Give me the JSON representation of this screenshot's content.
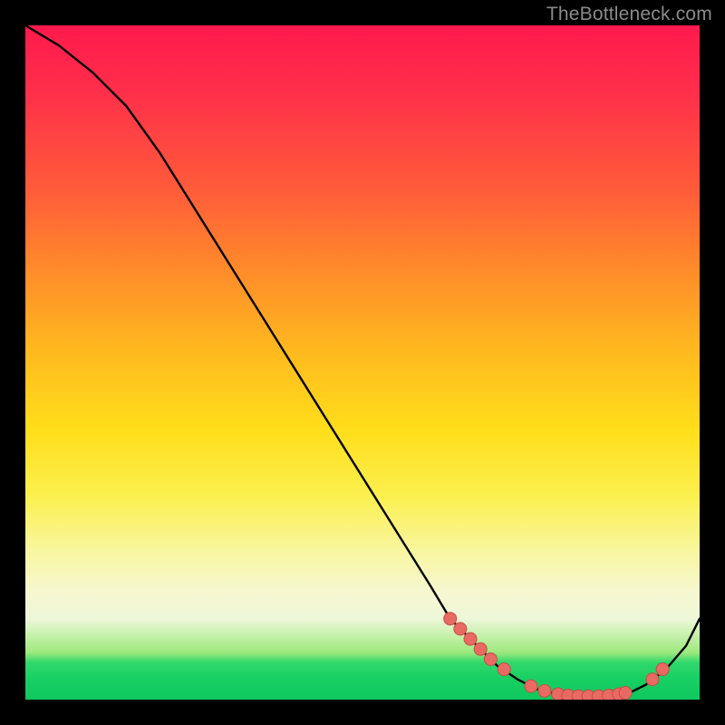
{
  "watermark_text": "TheBottleneck.com",
  "colors": {
    "page_bg": "#000000",
    "watermark": "#8a8a8a",
    "line": "#000000",
    "dot_fill": "#e86a63",
    "dot_stroke": "#c94c45"
  },
  "chart_data": {
    "type": "line",
    "title": "",
    "xlabel": "",
    "ylabel": "",
    "xlim": [
      0,
      100
    ],
    "ylim": [
      0,
      100
    ],
    "grid": false,
    "legend": false,
    "series": [
      {
        "name": "curve",
        "x": [
          0,
          5,
          10,
          15,
          20,
          25,
          30,
          35,
          40,
          45,
          50,
          55,
          60,
          63,
          65,
          67,
          70,
          73,
          76,
          79,
          82,
          85,
          88,
          90,
          92,
          95,
          98,
          100
        ],
        "y": [
          100,
          97,
          93,
          88,
          81,
          73,
          65,
          57,
          49,
          41,
          33,
          25,
          17,
          12,
          10,
          8,
          5,
          3,
          1.5,
          0.8,
          0.5,
          0.5,
          0.7,
          1.2,
          2.2,
          4.5,
          8,
          12
        ]
      }
    ],
    "markers": [
      {
        "x": 63,
        "y": 12
      },
      {
        "x": 64.5,
        "y": 10.5
      },
      {
        "x": 66,
        "y": 9
      },
      {
        "x": 67.5,
        "y": 7.5
      },
      {
        "x": 69,
        "y": 6
      },
      {
        "x": 71,
        "y": 4.5
      },
      {
        "x": 75,
        "y": 2
      },
      {
        "x": 77,
        "y": 1.3
      },
      {
        "x": 79,
        "y": 0.8
      },
      {
        "x": 80.5,
        "y": 0.6
      },
      {
        "x": 82,
        "y": 0.5
      },
      {
        "x": 83.5,
        "y": 0.5
      },
      {
        "x": 85,
        "y": 0.5
      },
      {
        "x": 86.5,
        "y": 0.6
      },
      {
        "x": 88,
        "y": 0.8
      },
      {
        "x": 89,
        "y": 1.0
      },
      {
        "x": 93,
        "y": 3.0
      },
      {
        "x": 94.5,
        "y": 4.5
      }
    ],
    "marker_abs_radius_px": 7
  }
}
